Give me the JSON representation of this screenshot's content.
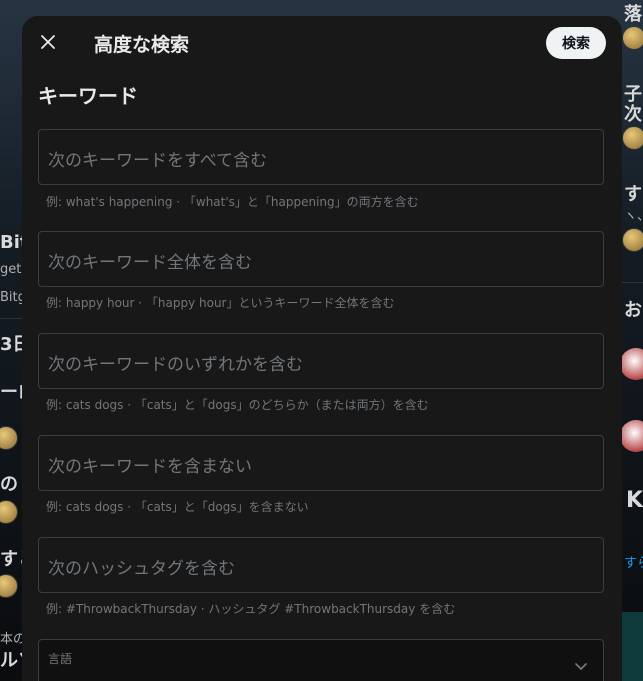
{
  "background": {
    "fragments": [
      {
        "name": "bg-fragment-bitg",
        "text": "Bitg"
      },
      {
        "name": "bg-fragment-get",
        "text": "get"
      },
      {
        "name": "bg-fragment-bitg2",
        "text": "Bitg"
      },
      {
        "name": "bg-fragment-day",
        "text": "3日"
      },
      {
        "name": "bg-fragment-ro",
        "text": "ーロ"
      },
      {
        "name": "bg-fragment-no",
        "text": "の"
      },
      {
        "name": "bg-fragment-suru",
        "text": "すと"
      },
      {
        "name": "bg-fragment-honno",
        "text": "本の"
      },
      {
        "name": "bg-fragment-ruso",
        "text": "ルソ"
      },
      {
        "name": "bg-fragment-ochi",
        "text": "落に"
      },
      {
        "name": "bg-fragment-ofno",
        "text": "子の"
      },
      {
        "name": "bg-fragment-tsugi",
        "text": "次の"
      },
      {
        "name": "bg-fragment-su",
        "text": "す"
      },
      {
        "name": "bg-fragment-a",
        "text": "ヽ、え"
      },
      {
        "name": "bg-fragment-osu",
        "text": "おす"
      },
      {
        "name": "bg-fragment-k",
        "text": "K"
      },
      {
        "name": "bg-fragment-sera",
        "text": "すら"
      }
    ]
  },
  "modal": {
    "title": "高度な検索",
    "search_button": "検索",
    "section_title": "キーワード",
    "fields": [
      {
        "name": "all-words-field",
        "placeholder": "次のキーワードをすべて含む",
        "hint": "例: what's happening · 「what's」と「happening」の両方を含む"
      },
      {
        "name": "exact-phrase-field",
        "placeholder": "次のキーワード全体を含む",
        "hint": "例: happy hour · 「happy hour」というキーワード全体を含む"
      },
      {
        "name": "any-words-field",
        "placeholder": "次のキーワードのいずれかを含む",
        "hint": "例: cats dogs · 「cats」と「dogs」のどちらか（または両方）を含む"
      },
      {
        "name": "none-words-field",
        "placeholder": "次のキーワードを含まない",
        "hint": "例: cats dogs · 「cats」と「dogs」を含まない"
      },
      {
        "name": "hashtags-field",
        "placeholder": "次のハッシュタグを含む",
        "hint": "例: #ThrowbackThursday · ハッシュタグ #ThrowbackThursday を含む"
      }
    ],
    "language": {
      "label": "言語"
    }
  }
}
